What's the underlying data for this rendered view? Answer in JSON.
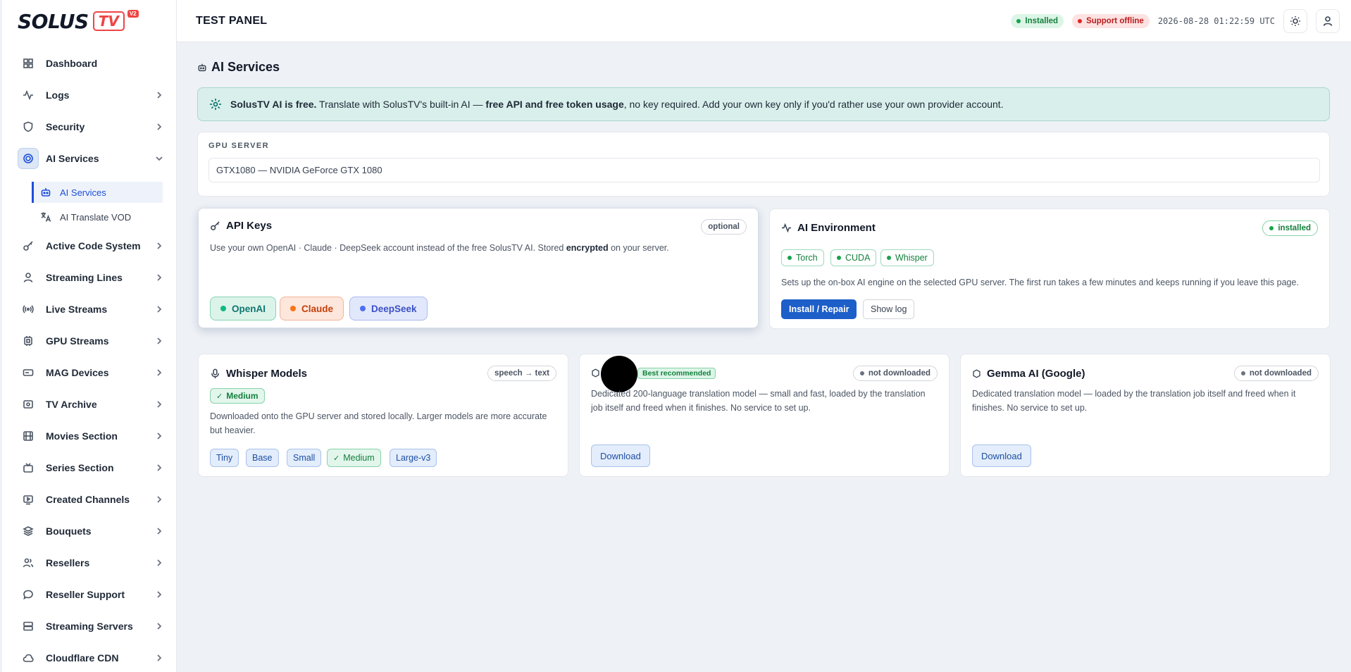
{
  "brand": {
    "name": "SOLUS",
    "tv": "TV",
    "version": "V2"
  },
  "sidebar": {
    "items": [
      {
        "label": "Dashboard",
        "icon": "grid-icon",
        "chevron": false
      },
      {
        "label": "Logs",
        "icon": "activity-icon",
        "chevron": true
      },
      {
        "label": "Security",
        "icon": "shield-icon",
        "chevron": true
      },
      {
        "label": "AI Services",
        "icon": "cpu-icon",
        "chevron": true,
        "active": true,
        "expanded": true
      },
      {
        "label": "Active Code System",
        "icon": "key-icon",
        "chevron": true
      },
      {
        "label": "Streaming Lines",
        "icon": "user-icon",
        "chevron": true
      },
      {
        "label": "Live Streams",
        "icon": "broadcast-icon",
        "chevron": true
      },
      {
        "label": "GPU Streams",
        "icon": "chip-icon",
        "chevron": true
      },
      {
        "label": "MAG Devices",
        "icon": "device-icon",
        "chevron": true
      },
      {
        "label": "TV Archive",
        "icon": "archive-icon",
        "chevron": true
      },
      {
        "label": "Movies Section",
        "icon": "film-icon",
        "chevron": true
      },
      {
        "label": "Series Section",
        "icon": "tv-icon",
        "chevron": true
      },
      {
        "label": "Created Channels",
        "icon": "play-screen-icon",
        "chevron": true
      },
      {
        "label": "Bouquets",
        "icon": "layers-icon",
        "chevron": true
      },
      {
        "label": "Resellers",
        "icon": "users-icon",
        "chevron": true
      },
      {
        "label": "Reseller Support",
        "icon": "chat-icon",
        "chevron": true
      },
      {
        "label": "Streaming Servers",
        "icon": "server-icon",
        "chevron": true
      },
      {
        "label": "Cloudflare CDN",
        "icon": "cloud-icon",
        "chevron": true
      }
    ],
    "subitems": [
      {
        "label": "AI Services",
        "icon": "robot-icon",
        "active": true
      },
      {
        "label": "AI Translate VOD",
        "icon": "translate-icon",
        "active": false
      }
    ]
  },
  "topbar": {
    "title": "TEST PANEL",
    "installed": "Installed",
    "support": "Support offline",
    "clock": "2026-08-28 01:22:59 UTC"
  },
  "page": {
    "title": "AI Services"
  },
  "banner": {
    "strong1": "SolusTV AI is free.",
    "text1": " Translate with SolusTV's built-in AI — ",
    "strong2": "free API and free token usage",
    "text2": ", no key required. Add your own key only if you'd rather use your own provider account."
  },
  "gpu": {
    "label": "GPU SERVER",
    "value": "GTX1080 — NVIDIA GeForce GTX 1080"
  },
  "api_keys": {
    "title": "API Keys",
    "tag": "optional",
    "desc_pre": "Use your own OpenAI · Claude · DeepSeek account instead of the free SolusTV AI. Stored ",
    "desc_bold": "encrypted",
    "desc_post": " on your server.",
    "providers": [
      "OpenAI",
      "Claude",
      "DeepSeek"
    ]
  },
  "ai_env": {
    "title": "AI Environment",
    "status": "installed",
    "chips": [
      "Torch",
      "CUDA",
      "Whisper"
    ],
    "desc": "Sets up the on-box AI engine on the selected GPU server. The first run takes a few minutes and keeps running if you leave this page.",
    "install_label": "Install / Repair",
    "log_label": "Show log"
  },
  "whisper": {
    "title": "Whisper Models",
    "tag": "speech → text",
    "selected": "Medium",
    "desc": "Downloaded onto the GPU server and stored locally. Larger models are more accurate but heavier.",
    "sizes": [
      "Tiny",
      "Base",
      "Small",
      "Medium",
      "Large-v3"
    ],
    "selected_index": 3
  },
  "translation_model": {
    "badge": "Best recommended",
    "status": "not downloaded",
    "desc": "Dedicated 200-language translation model — small and fast, loaded by the translation job itself and freed when it finishes. No service to set up.",
    "download_label": "Download"
  },
  "gemma": {
    "title": "Gemma AI (Google)",
    "status": "not downloaded",
    "desc": "Dedicated translation model — loaded by the translation job itself and freed when it finishes. No service to set up.",
    "download_label": "Download"
  }
}
